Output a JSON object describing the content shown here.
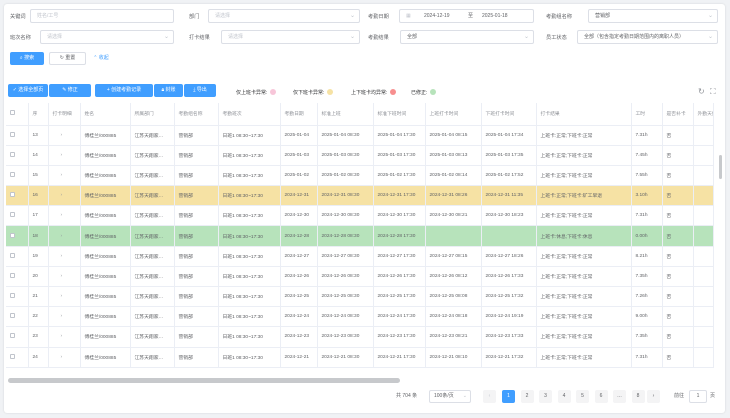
{
  "filters": {
    "keyword": {
      "label": "关键词",
      "placeholder": "姓名/工号"
    },
    "dept": {
      "label": "部门",
      "placeholder": "请选择"
    },
    "date": {
      "label": "考勤日期",
      "start": "2024-12-19",
      "sep": "至",
      "end": "2025-01-18"
    },
    "group": {
      "label": "考勤组名称",
      "value": "营销部"
    },
    "shift": {
      "label": "班次名称",
      "placeholder": "请选择"
    },
    "punch": {
      "label": "打卡结果",
      "placeholder": "请选择"
    },
    "result": {
      "label": "考勤结果",
      "value": "全部"
    },
    "status": {
      "label": "员工状态",
      "value": "全部（包含指定考勤日期范围内的离职人员）"
    }
  },
  "actions": {
    "search": "搜索",
    "reset": "重置",
    "collapse": "收起"
  },
  "toolbar": {
    "select_all": "选择全部页",
    "fix": "修正",
    "create": "创建考勤记录",
    "lock": "封账",
    "export": "导出"
  },
  "legend": [
    {
      "label": "仅上班卡异常:",
      "color": "#f7c6d9"
    },
    {
      "label": "仅下班卡异常:",
      "color": "#f6e2a4"
    },
    {
      "label": "上下班卡均异常:",
      "color": "#f78f8f"
    },
    {
      "label": "已修正:",
      "color": "#b7e3bb"
    }
  ],
  "columns": [
    "",
    "序",
    "打卡明细",
    "姓名",
    "所属部门",
    "考勤组名称",
    "考勤班次",
    "考勤日期",
    "标准上班",
    "标准下班时间",
    "上班打卡时间",
    "下班打卡时间",
    "打卡结果",
    "工时",
    "是否补卡",
    "外勤天数"
  ],
  "rows": [
    {
      "idx": "13",
      "name": "傅桂兰/000885",
      "dept": "江苏天翔家…",
      "group": "营销部",
      "shift": "日班1 08:30~17:30",
      "date": "2025-01-04",
      "std_in": "2025-01-04 08:30",
      "std_out": "2025-01-04 17:30",
      "in": "2025-01-04 08:15",
      "out": "2025-01-04 17:34",
      "result": "上班卡:正常;下班卡:正常",
      "hours": "7.31h",
      "makeup": "否",
      "state": ""
    },
    {
      "idx": "14",
      "name": "傅桂兰/000885",
      "dept": "江苏天翔家…",
      "group": "营销部",
      "shift": "日班1 08:30~17:30",
      "date": "2025-01-03",
      "std_in": "2025-01-03 08:30",
      "std_out": "2025-01-03 17:30",
      "in": "2025-01-03 08:13",
      "out": "2025-01-03 17:35",
      "result": "上班卡:正常;下班卡:正常",
      "hours": "7.45h",
      "makeup": "否",
      "state": ""
    },
    {
      "idx": "15",
      "name": "傅桂兰/000885",
      "dept": "江苏天翔家…",
      "group": "营销部",
      "shift": "日班1 08:30~17:30",
      "date": "2025-01-02",
      "std_in": "2025-01-02 08:30",
      "std_out": "2025-01-02 17:30",
      "in": "2025-01-02 08:14",
      "out": "2025-01-02 17:52",
      "result": "上班卡:正常;下班卡:正常",
      "hours": "7.55h",
      "makeup": "否",
      "state": ""
    },
    {
      "idx": "16",
      "name": "傅桂兰/000885",
      "dept": "江苏天翔家…",
      "group": "营销部",
      "shift": "日班1 08:30~17:30",
      "date": "2024-12-31",
      "std_in": "2024-12-31 08:30",
      "std_out": "2024-12-31 17:30",
      "in": "2024-12-31 08:26",
      "out": "2024-12-31 11:35",
      "result": "上班卡:正常;下班卡:矿工早退",
      "hours": "3.10h",
      "makeup": "否",
      "state": "yellow"
    },
    {
      "idx": "17",
      "name": "傅桂兰/000885",
      "dept": "江苏天翔家…",
      "group": "营销部",
      "shift": "日班1 08:30~17:30",
      "date": "2024-12-30",
      "std_in": "2024-12-30 08:30",
      "std_out": "2024-12-30 17:30",
      "in": "2024-12-30 08:21",
      "out": "2024-12-30 18:23",
      "result": "上班卡:正常;下班卡:正常",
      "hours": "7.31h",
      "makeup": "否",
      "state": ""
    },
    {
      "idx": "18",
      "name": "傅桂兰/000885",
      "dept": "江苏天翔家…",
      "group": "营销部",
      "shift": "日班1 08:30~17:30",
      "date": "2024-12-28",
      "std_in": "2024-12-28 08:30",
      "std_out": "2024-12-28 17:30",
      "in": "",
      "out": "",
      "result": "上班卡:休息;下班卡:休息",
      "hours": "0.00h",
      "makeup": "否",
      "state": "green"
    },
    {
      "idx": "19",
      "name": "傅桂兰/000885",
      "dept": "江苏天翔家…",
      "group": "营销部",
      "shift": "日班1 08:30~17:30",
      "date": "2024-12-27",
      "std_in": "2024-12-27 08:30",
      "std_out": "2024-12-27 17:30",
      "in": "2024-12-27 08:15",
      "out": "2024-12-27 18:26",
      "result": "上班卡:正常;下班卡:正常",
      "hours": "8.21h",
      "makeup": "否",
      "state": ""
    },
    {
      "idx": "20",
      "name": "傅桂兰/000885",
      "dept": "江苏天翔家…",
      "group": "营销部",
      "shift": "日班1 08:30~17:30",
      "date": "2024-12-26",
      "std_in": "2024-12-26 08:30",
      "std_out": "2024-12-26 17:30",
      "in": "2024-12-26 08:12",
      "out": "2024-12-26 17:33",
      "result": "上班卡:正常;下班卡:正常",
      "hours": "7.35h",
      "makeup": "否",
      "state": ""
    },
    {
      "idx": "21",
      "name": "傅桂兰/000885",
      "dept": "江苏天翔家…",
      "group": "营销部",
      "shift": "日班1 08:30~17:30",
      "date": "2024-12-25",
      "std_in": "2024-12-25 08:30",
      "std_out": "2024-12-25 17:30",
      "in": "2024-12-25 08:08",
      "out": "2024-12-25 17:32",
      "result": "上班卡:正常;下班卡:正常",
      "hours": "7.26h",
      "makeup": "否",
      "state": ""
    },
    {
      "idx": "22",
      "name": "傅桂兰/000885",
      "dept": "江苏天翔家…",
      "group": "营销部",
      "shift": "日班1 08:30~17:30",
      "date": "2024-12-24",
      "std_in": "2024-12-24 08:30",
      "std_out": "2024-12-24 17:30",
      "in": "2024-12-24 08:18",
      "out": "2024-12-24 19:19",
      "result": "上班卡:正常;下班卡:正常",
      "hours": "9.00h",
      "makeup": "否",
      "state": ""
    },
    {
      "idx": "23",
      "name": "傅桂兰/000885",
      "dept": "江苏天翔家…",
      "group": "营销部",
      "shift": "日班1 08:30~17:30",
      "date": "2024-12-23",
      "std_in": "2024-12-23 08:30",
      "std_out": "2024-12-23 17:30",
      "in": "2024-12-23 08:21",
      "out": "2024-12-23 17:33",
      "result": "上班卡:正常;下班卡:正常",
      "hours": "7.35h",
      "makeup": "否",
      "state": ""
    },
    {
      "idx": "24",
      "name": "傅桂兰/000885",
      "dept": "江苏天翔家…",
      "group": "营销部",
      "shift": "日班1 08:30~17:30",
      "date": "2024-12-21",
      "std_in": "2024-12-21 08:30",
      "std_out": "2024-12-21 17:30",
      "in": "2024-12-21 08:10",
      "out": "2024-12-21 17:32",
      "result": "上班卡:正常;下班卡:正常",
      "hours": "7.31h",
      "makeup": "否",
      "state": ""
    }
  ],
  "pagination": {
    "total": "共 704 条",
    "size": "100条/页",
    "pages": [
      "1",
      "2",
      "3",
      "4",
      "5",
      "6",
      "…",
      "8"
    ],
    "current": "1",
    "goto_label": "前往",
    "goto_value": "1",
    "goto_suffix": "页"
  }
}
